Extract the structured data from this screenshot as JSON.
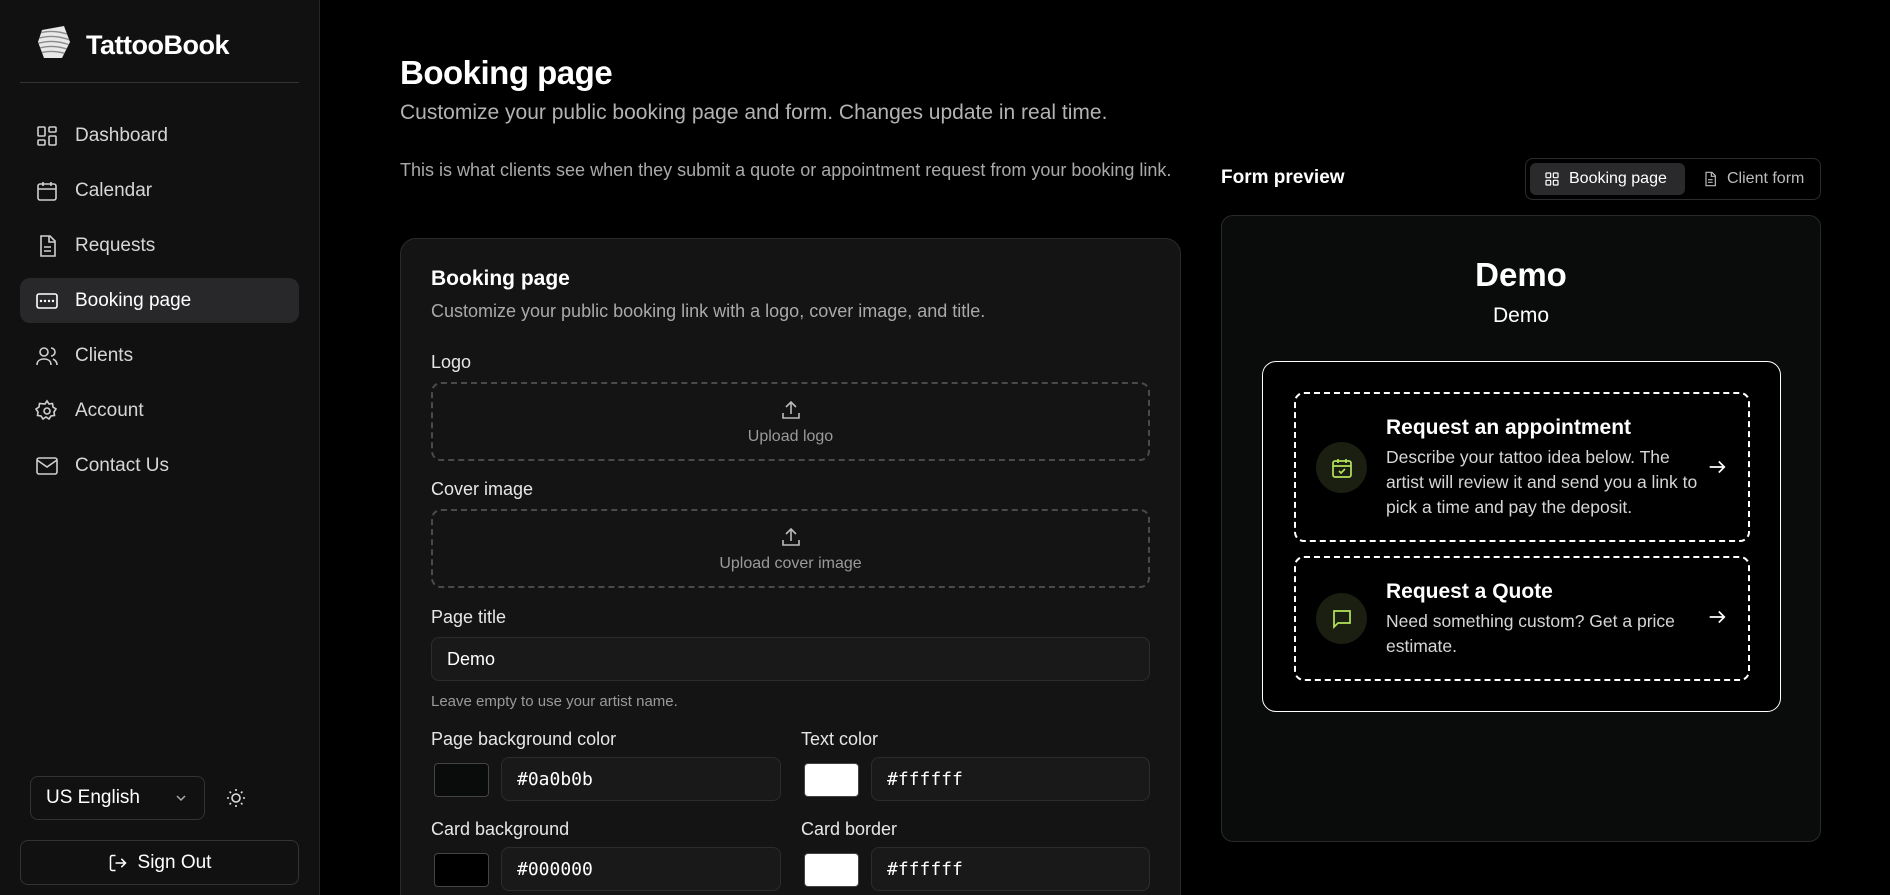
{
  "app": {
    "name": "TattooBook"
  },
  "sidebar": {
    "items": [
      {
        "label": "Dashboard",
        "icon": "dashboard-icon"
      },
      {
        "label": "Calendar",
        "icon": "calendar-icon"
      },
      {
        "label": "Requests",
        "icon": "file-icon"
      },
      {
        "label": "Booking page",
        "icon": "card-icon",
        "active": true
      },
      {
        "label": "Clients",
        "icon": "users-icon"
      },
      {
        "label": "Account",
        "icon": "gear-icon"
      },
      {
        "label": "Contact Us",
        "icon": "mail-icon"
      }
    ],
    "language": "US English",
    "sign_out": "Sign Out"
  },
  "main": {
    "title": "Booking page",
    "subtitle": "Customize your public booking page and form. Changes update in real time.",
    "intro": "This is what clients see when they submit a quote or appointment request from your booking link."
  },
  "card": {
    "title": "Booking page",
    "subtitle": "Customize your public booking link with a logo, cover image, and title.",
    "logo_label": "Logo",
    "logo_upload": "Upload logo",
    "cover_label": "Cover image",
    "cover_upload": "Upload cover image",
    "page_title_label": "Page title",
    "page_title_value": "Demo",
    "page_title_hint": "Leave empty to use your artist name.",
    "bg_color_label": "Page background color",
    "bg_color_value": "#0a0b0b",
    "text_color_label": "Text color",
    "text_color_value": "#ffffff",
    "card_bg_label": "Card background",
    "card_bg_value": "#000000",
    "card_border_label": "Card border",
    "card_border_value": "#ffffff"
  },
  "preview": {
    "label": "Form preview",
    "tab_booking": "Booking page",
    "tab_client": "Client form",
    "title": "Demo",
    "subtitle": "Demo",
    "appointment_title": "Request an appointment",
    "appointment_desc": "Describe your tattoo idea below. The artist will review it and send you a link to pick a time and pay the deposit.",
    "quote_title": "Request a Quote",
    "quote_desc": "Need something custom? Get a price estimate.",
    "accent_color": "#b4e35a"
  }
}
